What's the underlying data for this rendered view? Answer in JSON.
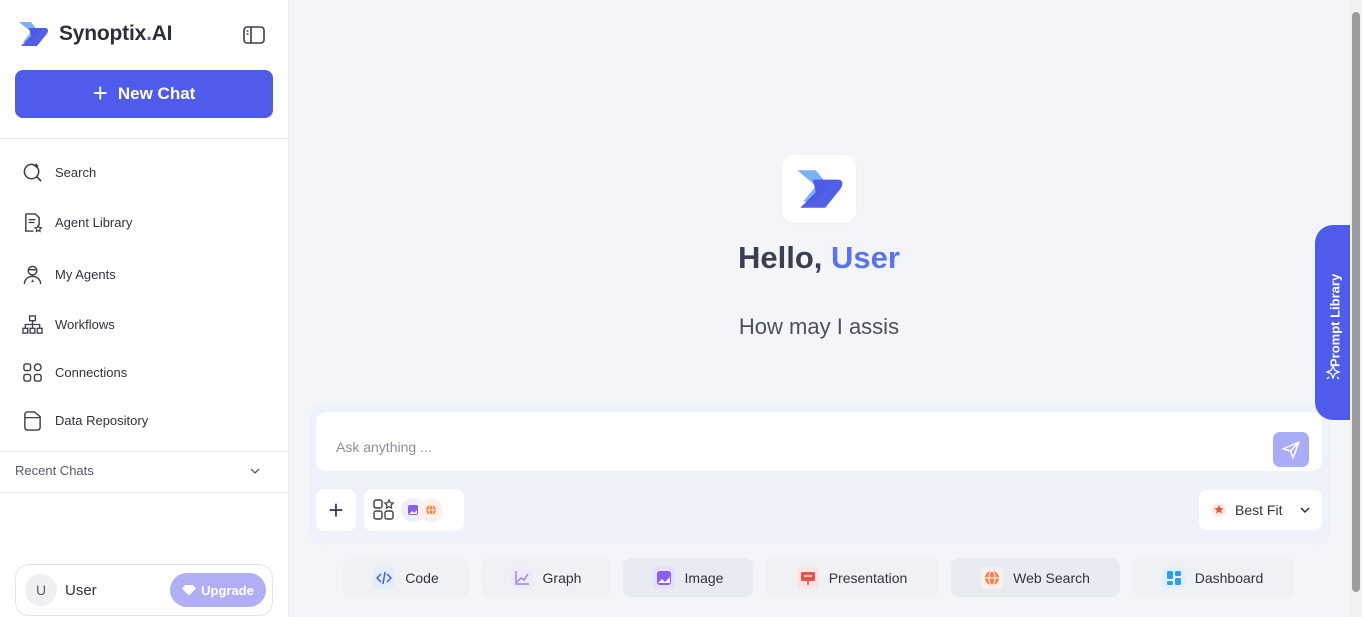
{
  "brand": {
    "name": "Synoptix",
    "dot": ".",
    "suffix": "AI"
  },
  "sidebar": {
    "new_chat_label": "New Chat",
    "items": [
      {
        "label": "Search",
        "icon": "search-icon"
      },
      {
        "label": "Agent Library",
        "icon": "agent-library-icon"
      },
      {
        "label": "My Agents",
        "icon": "agent-icon"
      },
      {
        "label": "Workflows",
        "icon": "workflow-icon"
      },
      {
        "label": "Connections",
        "icon": "connections-icon"
      },
      {
        "label": "Data Repository",
        "icon": "folder-icon"
      }
    ],
    "recent_chats_label": "Recent Chats",
    "user": {
      "initial": "U",
      "name": "User",
      "upgrade_label": "Upgrade"
    }
  },
  "main": {
    "greeting_prefix": "Hello,",
    "greeting_name": "User",
    "subtitle": "How may I assis",
    "input_placeholder": "Ask anything ...",
    "model_label": "Best Fit",
    "chips": [
      {
        "label": "Code",
        "icon": "code-icon"
      },
      {
        "label": "Graph",
        "icon": "graph-icon"
      },
      {
        "label": "Image",
        "icon": "image-icon"
      },
      {
        "label": "Presentation",
        "icon": "presentation-icon"
      },
      {
        "label": "Web Search",
        "icon": "globe-icon"
      },
      {
        "label": "Dashboard",
        "icon": "dashboard-icon"
      }
    ],
    "prompt_library_label": "Prompt Library"
  },
  "colors": {
    "accent": "#4f5bea",
    "upgrade": "#b2aef6",
    "send": "#a9acf6"
  }
}
